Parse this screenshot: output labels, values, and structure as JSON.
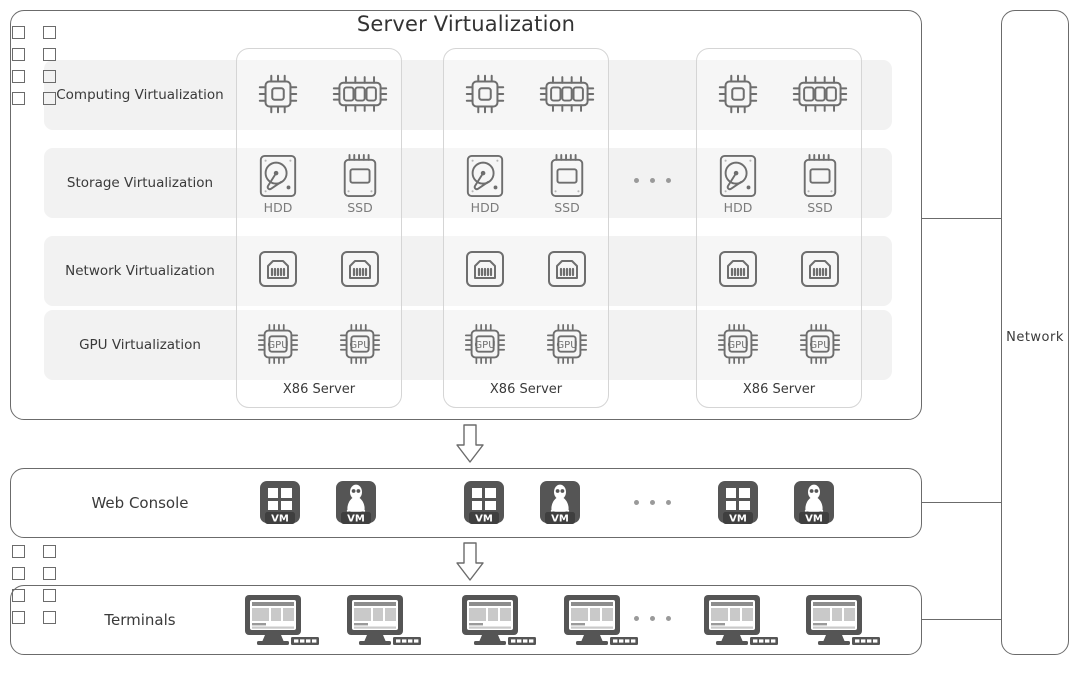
{
  "diagram": {
    "title": "Server Virtualization",
    "layers": [
      {
        "id": "compute",
        "label": "Computing Virtualization"
      },
      {
        "id": "storage",
        "label": "Storage Virtualization"
      },
      {
        "id": "network",
        "label": "Network Virtualization"
      },
      {
        "id": "gpu",
        "label": "GPU Virtualization"
      }
    ],
    "servers": [
      {
        "caption": "X86 Server"
      },
      {
        "caption": "X86 Server"
      },
      {
        "caption": "X86 Server"
      }
    ],
    "storage_captions": {
      "hdd": "HDD",
      "ssd": "SSD"
    },
    "gpu_icon_text": "GPU",
    "vm_badge_text": "VM",
    "console": {
      "label": "Web Console",
      "vms": [
        {
          "os": "windows",
          "badge": "VM"
        },
        {
          "os": "linux",
          "badge": "VM"
        },
        {
          "os": "windows",
          "badge": "VM"
        },
        {
          "os": "linux",
          "badge": "VM"
        },
        {
          "os": "windows",
          "badge": "VM"
        },
        {
          "os": "linux",
          "badge": "VM"
        }
      ]
    },
    "terminals": {
      "label": "Terminals",
      "count": 6
    },
    "network": {
      "label": "Network",
      "port_rows": 4,
      "port_cols": 2
    },
    "ellipsis_glyph": "• • •",
    "icons": {
      "cpu_single": "cpu-single-core-icon",
      "cpu_multi": "cpu-multi-core-icon",
      "hdd": "hard-disk-drive-icon",
      "ssd": "solid-state-drive-icon",
      "nic": "rj45-network-port-icon",
      "gpu": "gpu-chip-icon",
      "windows_vm": "windows-vm-icon",
      "linux_vm": "linux-vm-icon",
      "terminal": "desktop-terminal-icon",
      "flow_arrow": "down-arrow-icon"
    },
    "colors": {
      "outline": "#6b6b6b",
      "band": "#f2f2f2",
      "icon_stroke": "#6e6e6e",
      "vm_tile": "#555555",
      "text": "#3a3a3a"
    }
  }
}
